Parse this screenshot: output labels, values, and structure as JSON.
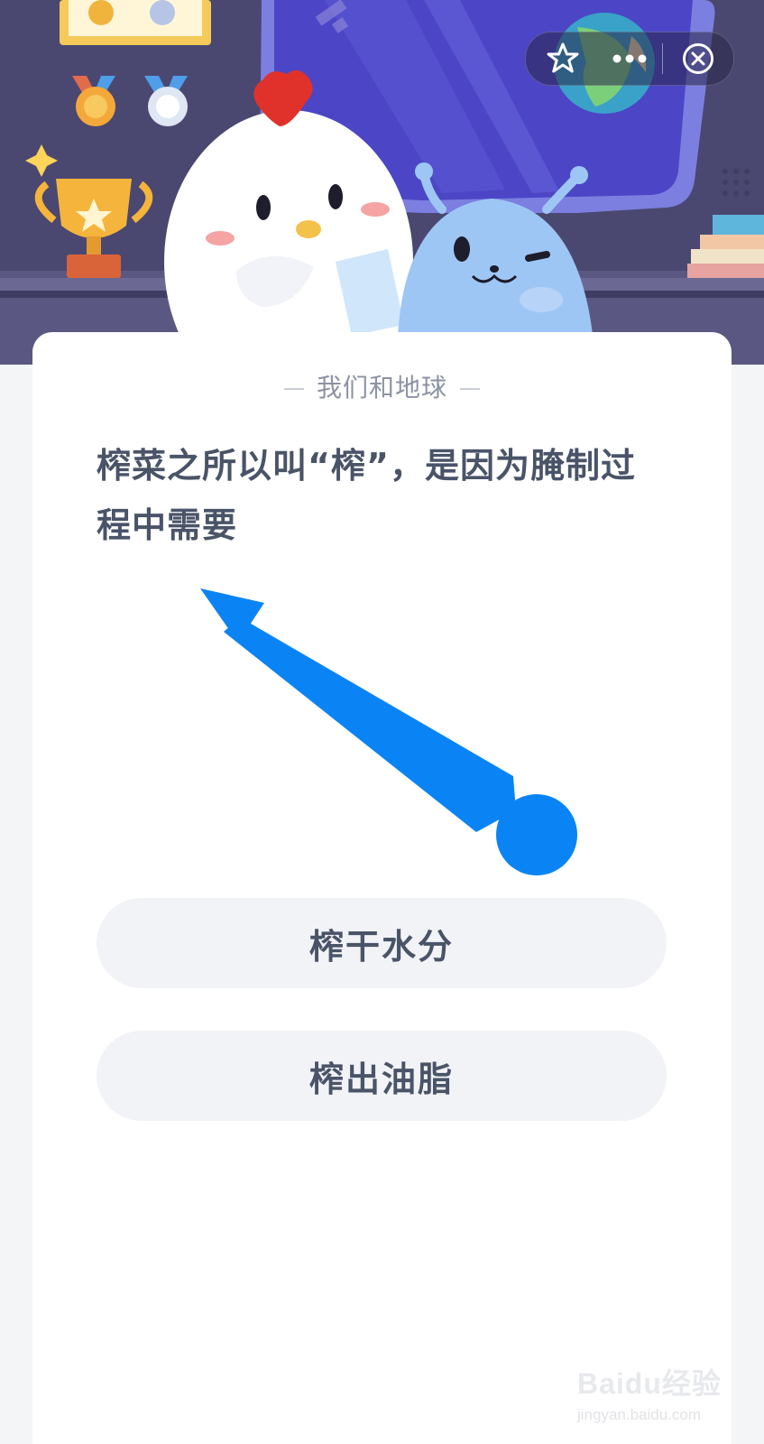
{
  "capsule": {
    "favorite_icon": "star-icon",
    "more_icon": "more-dots-icon",
    "close_icon": "close-circle-icon"
  },
  "quiz": {
    "category": "我们和地球",
    "question_line1": "榨菜之所以叫“榨”，是因为腌制过",
    "question_line2": "程中需要",
    "options": [
      {
        "label": "榨干水分"
      },
      {
        "label": "榨出油脂"
      }
    ]
  },
  "annotation": {
    "arrow_color": "#0a84f5"
  },
  "watermark": {
    "main": "Baidu经验",
    "sub": "jingyan.baidu.com"
  },
  "colors": {
    "hero_background": "#4b4970",
    "text_primary": "#4a5468",
    "option_background": "#f2f3f6"
  }
}
